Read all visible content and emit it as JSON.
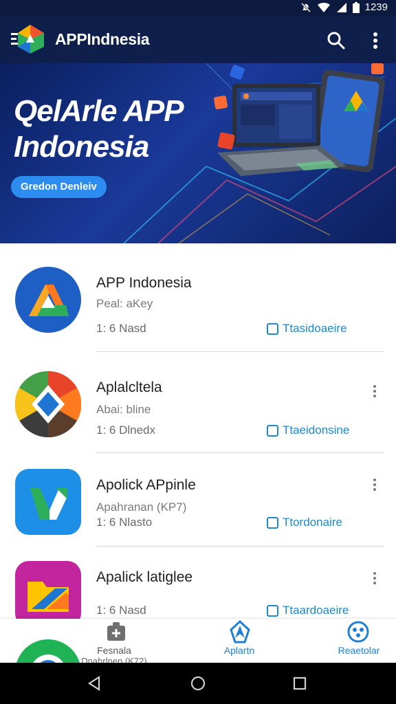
{
  "status_bar": {
    "time": "1239"
  },
  "app_bar": {
    "title": "APPIndnesia",
    "icons": [
      "logo-icon",
      "search-icon",
      "more-vert-icon"
    ]
  },
  "banner": {
    "title_line1": "QelArle APP",
    "title_line2": "Indonesia",
    "button": "Gredon Denleiv"
  },
  "apps": [
    {
      "name": "APP Indonesia",
      "subtitle": "Peal: aKey",
      "meta": "1: 6 Nasd",
      "action": "Ttasidoaeire",
      "icon": "triangle-a-icon"
    },
    {
      "name": "Aplalcltela",
      "subtitle": "Abai: bline",
      "meta": "1: 6 Dlnedx",
      "action": "Ttaeidonsine",
      "icon": "pinwheel-icon"
    },
    {
      "name": "Apolick APpinle",
      "subtitle": "Apahranan (KP7)",
      "meta": "1: 6 Nlasto",
      "action": "Ttordonaire",
      "icon": "n-letter-icon"
    },
    {
      "name": "Apalick latiglee",
      "subtitle": "",
      "meta": "1: 6 Nasd",
      "action": "Ttaardoaeire",
      "icon": "folder-icon"
    }
  ],
  "bottom_nav": {
    "items": [
      {
        "label": "Fesnala",
        "icon": "add-box-icon",
        "active": false
      },
      {
        "label": "Aplartn",
        "icon": "explore-icon",
        "active": true
      },
      {
        "label": "Reaetolar",
        "icon": "settings-dots-icon",
        "active": true
      }
    ],
    "peek_text": "Dnahrlnen (K72)"
  },
  "colors": {
    "app_bar": "#0e1f4b",
    "accent": "#1e88c8",
    "nav_active": "#1e7fd6"
  }
}
